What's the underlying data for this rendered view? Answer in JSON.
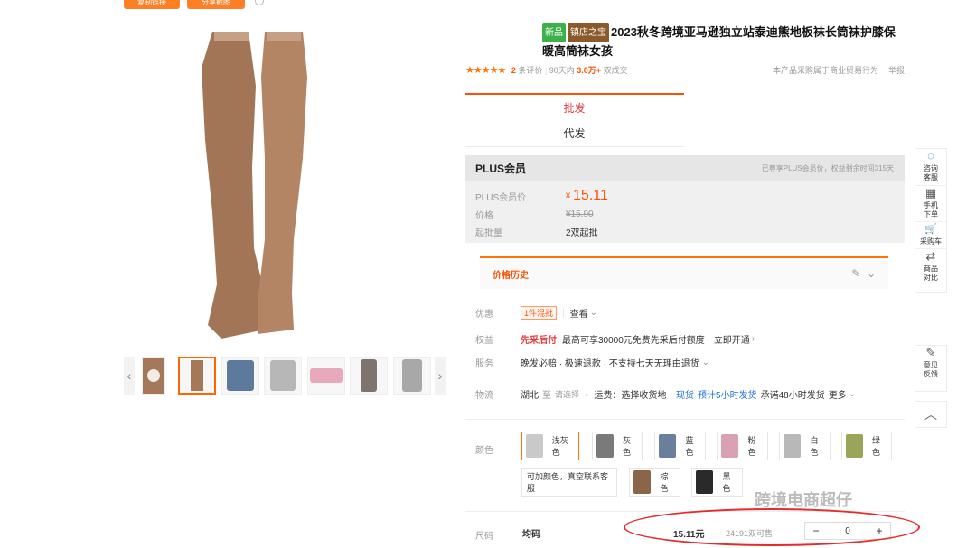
{
  "top_buttons": [
    "复制链接",
    "分享截图"
  ],
  "product": {
    "tag_new": "新品",
    "tag_shop": "镇店之宝",
    "title": "2023秋冬跨境亚马逊独立站泰迪熊地板袜长筒袜护膝保暖高筒袜女孩"
  },
  "rating": {
    "stars": "★★★★★",
    "review_count": "2",
    "review_label": "条评价",
    "period": "90天内",
    "sold": "3.0万+",
    "sold_label": "双成交",
    "business_note": "本产品采购属于商业贸易行为",
    "report": "举报"
  },
  "mode_tabs": [
    {
      "label": "批发",
      "active": true
    },
    {
      "label": "代发",
      "active": false
    }
  ],
  "plus": {
    "title": "PLUS会员",
    "right_note": "已尊享PLUS会员价，权益剩余时间315天",
    "member_price_label": "PLUS会员价",
    "currency": "¥",
    "member_price": "15.11",
    "price_label": "价格",
    "original_price": "¥15.90",
    "moq_label": "起批量",
    "moq": "2双起批"
  },
  "price_history": {
    "label": "价格历史"
  },
  "rows": {
    "discount_label": "优惠",
    "discount_badge": "1件混批",
    "discount_link": "查看",
    "rights_label": "权益",
    "rights_highlight": "先采后付",
    "rights_text": "最高可享30000元免费先采后付额度",
    "rights_action": "立即开通",
    "service_label": "服务",
    "service_text": "晚发必赔 · 极速退款 · 不支持七天无理由退货",
    "logistics_label": "物流",
    "origin": "湖北",
    "to": "至",
    "choose": "请选择",
    "freight": "运费：选择收货地",
    "stock": "现货",
    "ship_estimate": "预计5小时发货",
    "promise": "承诺48小时发货",
    "more": "更多"
  },
  "color_label": "颜色",
  "colors": [
    {
      "label": "浅灰色",
      "swatch": "#c9c9c9"
    },
    {
      "label": "灰色",
      "swatch": "#7a7a7a"
    },
    {
      "label": "蓝色",
      "swatch": "#6a7f9c"
    },
    {
      "label": "粉色",
      "swatch": "#d9a1b3"
    },
    {
      "label": "白色",
      "swatch": "#b8b8b8"
    },
    {
      "label": "绿色",
      "swatch": "#9aa55a"
    },
    {
      "label": "可加颜色，真空联系客服",
      "swatch": ""
    },
    {
      "label": "棕色",
      "swatch": "#8a6547"
    },
    {
      "label": "黑色",
      "swatch": "#2a2a2a"
    }
  ],
  "size": {
    "label": "尺码",
    "value": "均码",
    "price": "15.11元",
    "stock": "24191双可售",
    "minus": "−",
    "qty": "0",
    "plus": "+"
  },
  "sidebar": [
    {
      "icon": "◌",
      "label": "咨询客服"
    },
    {
      "icon": "▦",
      "label": "手机下单"
    },
    {
      "icon": "🛒",
      "label": "采购车"
    },
    {
      "icon": "⇄",
      "label": "商品对比"
    },
    {
      "icon": "✎",
      "label": "意见反馈"
    }
  ],
  "up_icon": "︿",
  "watermark": "跨境电商超仔",
  "colors_theme": {
    "accent": "#ff7300",
    "red": "#e4393c"
  }
}
